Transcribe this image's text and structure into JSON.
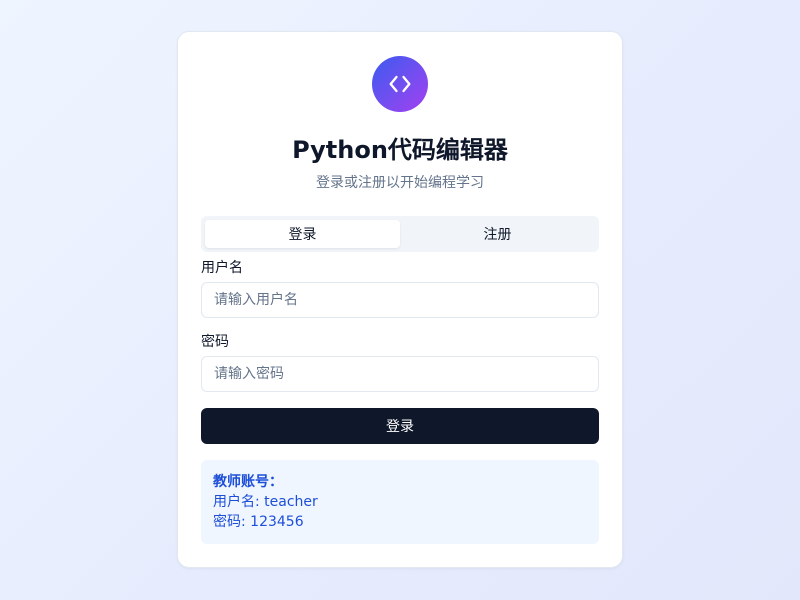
{
  "app": {
    "logo_icon": "code-brackets-icon",
    "title": "Python代码编辑器",
    "subtitle": "登录或注册以开始编程学习",
    "accent_gradient": [
      "#3b5bf0",
      "#a43ff0"
    ]
  },
  "tabs": [
    {
      "label": "登录",
      "active": true
    },
    {
      "label": "注册",
      "active": false
    }
  ],
  "form": {
    "username_label": "用户名",
    "username_placeholder": "请输入用户名",
    "username_value": "",
    "password_label": "密码",
    "password_placeholder": "请输入密码",
    "password_value": "",
    "submit_label": "登录",
    "submit_color": "#0f172a"
  },
  "info": {
    "title": "教师账号：",
    "username_line": "用户名: teacher",
    "password_line": "密码: 123456",
    "text_color": "#1d4ed8",
    "bg_color": "#eff6ff"
  }
}
